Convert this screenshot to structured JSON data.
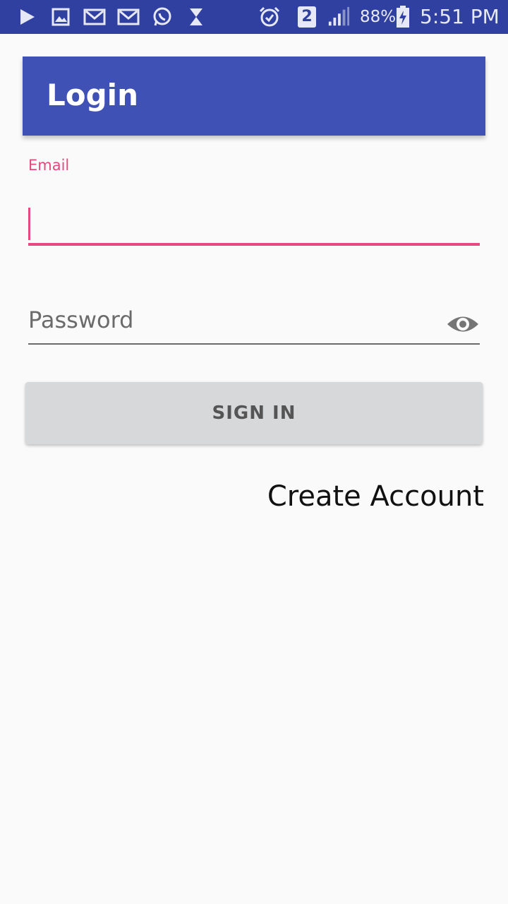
{
  "status_bar": {
    "battery": "88%",
    "time": "5:51 PM",
    "sim_slot": "2",
    "icons": [
      "play-store-icon",
      "gallery-icon",
      "gmail-icon",
      "gmail-icon",
      "whatsapp-icon",
      "hourglass-icon",
      "alarm-icon",
      "sim-2-icon",
      "signal-icon",
      "battery-charging-icon"
    ]
  },
  "app_bar": {
    "title": "Login"
  },
  "form": {
    "email_label": "Email",
    "email_value": "",
    "password_placeholder": "Password",
    "sign_in_label": "SIGN IN",
    "create_account_label": "Create Account"
  },
  "colors": {
    "status_bar": "#3040a0",
    "primary": "#3f51b5",
    "accent": "#e8477f",
    "button": "#d7d8d9"
  }
}
